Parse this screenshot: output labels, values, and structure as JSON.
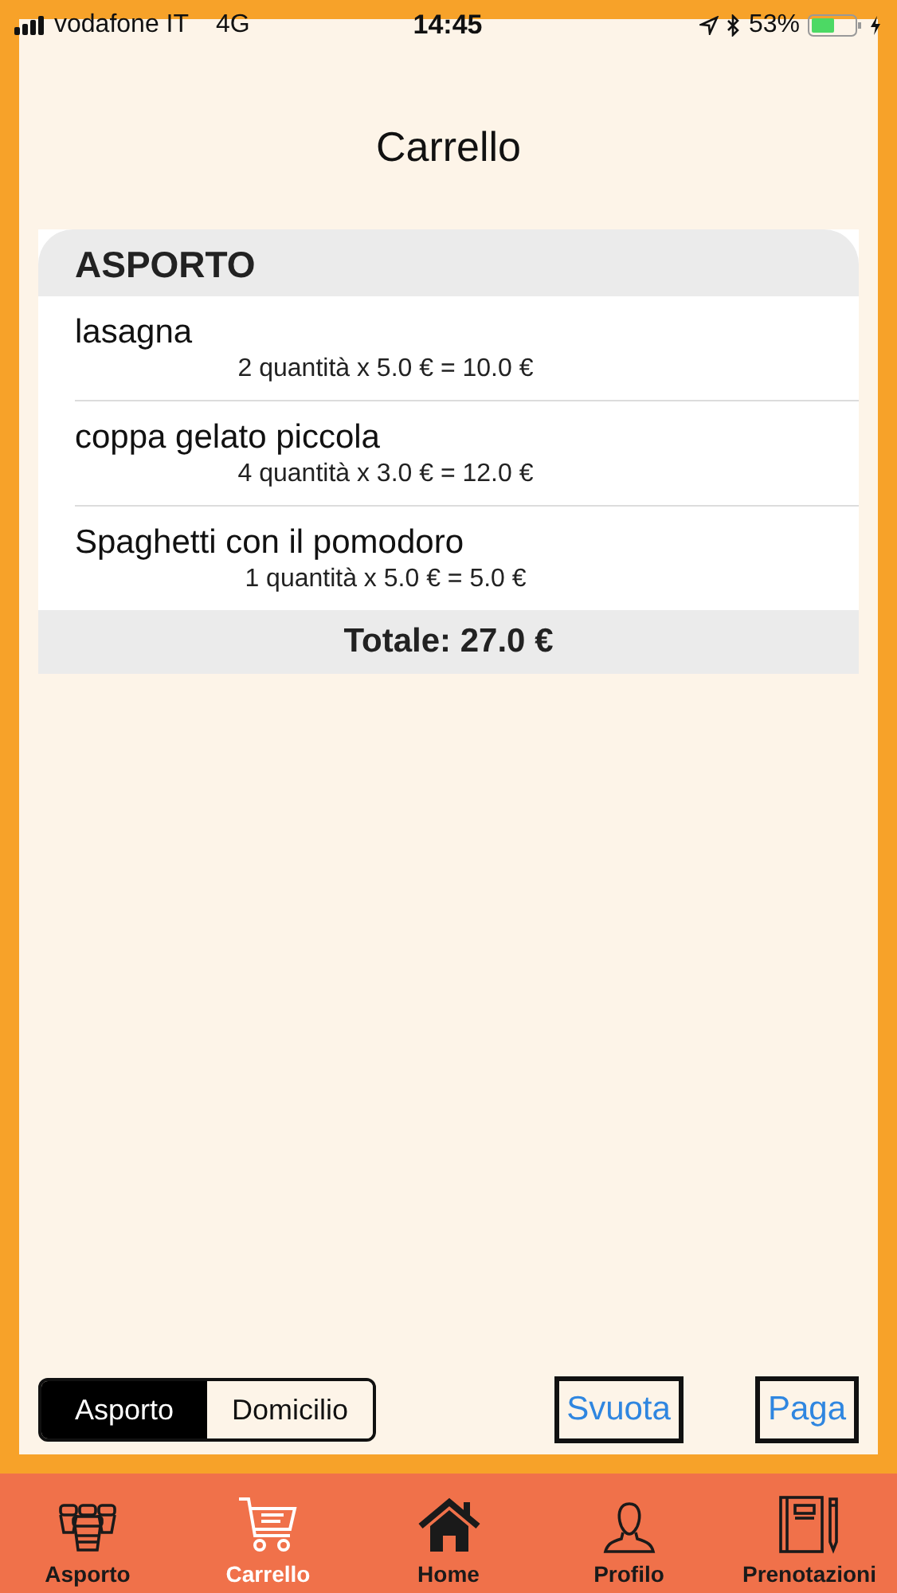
{
  "status_bar": {
    "carrier": "vodafone IT",
    "network": "4G",
    "time": "14:45",
    "battery": "53%"
  },
  "title": "Carrello",
  "order": {
    "header": "ASPORTO",
    "items": [
      {
        "name": "lasagna",
        "detail": "2 quantità x 5.0 € = 10.0 €"
      },
      {
        "name": "coppa gelato piccola",
        "detail": "4 quantità x 3.0 € = 12.0 €"
      },
      {
        "name": "Spaghetti con il pomodoro",
        "detail": "1 quantità x 5.0 € = 5.0 €"
      }
    ],
    "total": "Totale: 27.0 €"
  },
  "delivery_mode": [
    {
      "label": "Asporto",
      "selected": true
    },
    {
      "label": "Domicilio",
      "selected": false
    }
  ],
  "buttons": [
    "Svuota",
    "Paga"
  ],
  "tabs": [
    {
      "label": "Asporto",
      "selected": false
    },
    {
      "label": "Carrello",
      "selected": true
    },
    {
      "label": "Home",
      "selected": false
    },
    {
      "label": "Profilo",
      "selected": false
    },
    {
      "label": "Prenotazioni",
      "selected": false
    }
  ]
}
